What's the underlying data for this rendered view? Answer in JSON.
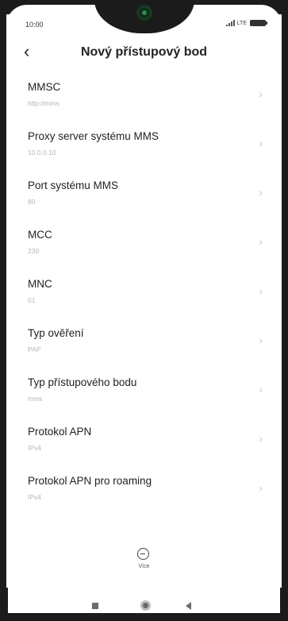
{
  "status_bar": {
    "time": "10:00",
    "network": "LTE"
  },
  "header": {
    "back_icon": "chevron-left-icon",
    "title": "Nový přístupový bod"
  },
  "list": {
    "items": [
      {
        "label": "MMSC",
        "value": "http://mms"
      },
      {
        "label": "Proxy server systému MMS",
        "value": "10.0.0.10"
      },
      {
        "label": "Port systému MMS",
        "value": "80"
      },
      {
        "label": "MCC",
        "value": "230"
      },
      {
        "label": "MNC",
        "value": "01"
      },
      {
        "label": "Typ ověření",
        "value": "PAP"
      },
      {
        "label": "Typ přístupového bodu",
        "value": "mms"
      },
      {
        "label": "Protokol APN",
        "value": "IPv4"
      },
      {
        "label": "Protokol APN pro roaming",
        "value": "IPv4"
      }
    ]
  },
  "footer": {
    "more_label": "Více",
    "more_icon": "minus-circle-icon"
  },
  "navigation_bar": {
    "recent_icon": "square-icon",
    "home_icon": "circle-home-icon",
    "back_icon": "triangle-back-icon"
  }
}
